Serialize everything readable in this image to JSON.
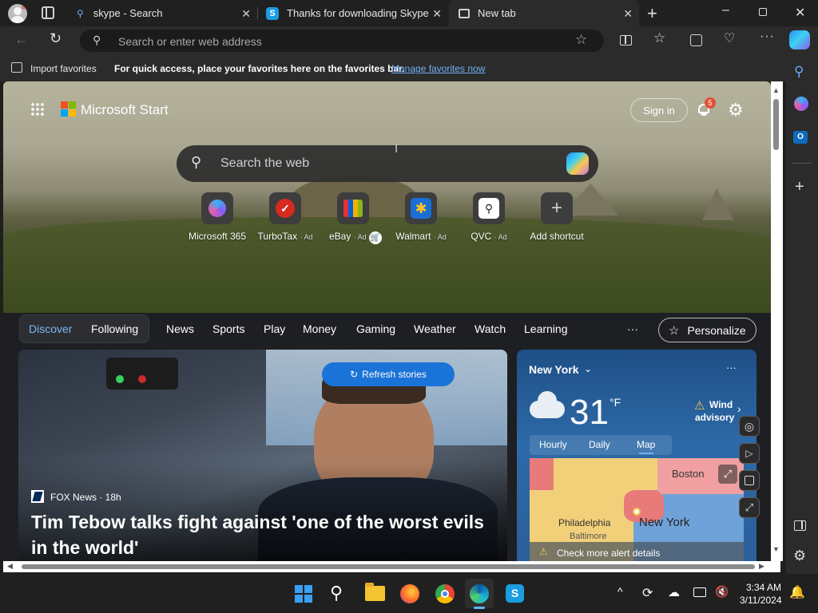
{
  "browser": {
    "tabs": [
      {
        "title": "skype - Search",
        "icon": "search-icon"
      },
      {
        "title": "Thanks for downloading Skype",
        "icon": "skype-icon"
      },
      {
        "title": "New tab",
        "icon": "newtab-icon",
        "active": true
      }
    ],
    "address_placeholder": "Search or enter web address",
    "favorites_bar": {
      "import_label": "Import favorites",
      "hint": "For quick access, place your favorites here on the favorites bar.",
      "manage_link": "Manage favorites now"
    }
  },
  "start_page": {
    "brand": "Microsoft Start",
    "sign_in": "Sign in",
    "notification_count": "5",
    "search_placeholder": "Search the web",
    "quick_links": [
      {
        "label": "Microsoft 365",
        "ad": ""
      },
      {
        "label": "TurboTax",
        "ad": "· Ad"
      },
      {
        "label": "eBay",
        "ad": "· Ad"
      },
      {
        "label": "Walmart",
        "ad": "· Ad"
      },
      {
        "label": "QVC",
        "ad": "· Ad"
      },
      {
        "label": "Add shortcut",
        "ad": ""
      }
    ],
    "nav": {
      "discover": "Discover",
      "following": "Following",
      "items": [
        "News",
        "Sports",
        "Play",
        "Money",
        "Gaming",
        "Weather",
        "Watch",
        "Learning"
      ],
      "more": "···",
      "personalize": "Personalize"
    },
    "hero_story": {
      "refresh": "Refresh stories",
      "source": "FOX News · 18h",
      "headline": "Tim Tebow talks fight against 'one of the worst evils in the world'"
    },
    "weather": {
      "city": "New York",
      "temp": "31",
      "unit": "°F",
      "alert_line1": "Wind",
      "alert_line2": "advisory",
      "tabs": [
        "Hourly",
        "Daily",
        "Map"
      ],
      "map_labels": {
        "boston": "Boston",
        "philadelphia": "Philadelphia",
        "baltimore": "Baltimore",
        "newyork": "New York"
      },
      "alert_link": "Check more alert details"
    }
  },
  "taskbar": {
    "time": "3:34 AM",
    "date": "3/11/2024"
  },
  "colors": {
    "accent_link": "#6fb0f5",
    "refresh_button": "#1a73d6",
    "badge": "#e0523b",
    "alert_yellow": "#f2c94c"
  }
}
